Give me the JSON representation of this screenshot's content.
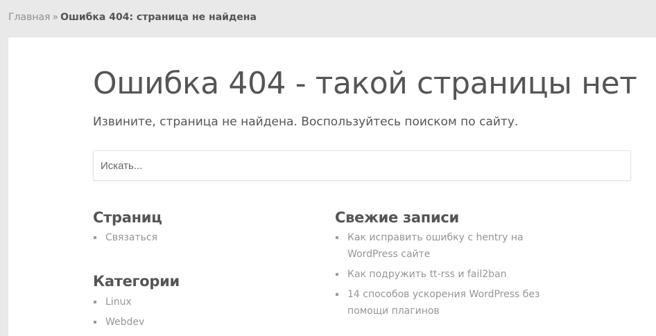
{
  "breadcrumb": {
    "home_label": "Главная",
    "separator": "»",
    "current": "Ошибка 404: страница не найдена"
  },
  "main": {
    "title": "Ошибка 404 - такой страницы нет",
    "subtitle": "Извините, страница не найдена. Воспользуйтесь поиском по сайту.",
    "search": {
      "placeholder": "Искать...",
      "value": ""
    }
  },
  "widgets": {
    "pages": {
      "title": "Страниц",
      "items": [
        {
          "label": "Связаться"
        }
      ]
    },
    "categories": {
      "title": "Категории",
      "items": [
        {
          "label": "Linux"
        },
        {
          "label": "Webdev"
        }
      ]
    },
    "recent_posts": {
      "title": "Свежие записи",
      "items": [
        {
          "label": "Как исправить ошибку с hentry на WordPress сайте"
        },
        {
          "label": "Как подружить tt-rss и fail2ban"
        },
        {
          "label": "14 способов ускорения WordPress без помощи плагинов"
        }
      ]
    }
  },
  "colors": {
    "page_background": "#e9e9e9",
    "panel_background": "#ffffff",
    "text": "#555555",
    "link_muted": "#959595"
  }
}
